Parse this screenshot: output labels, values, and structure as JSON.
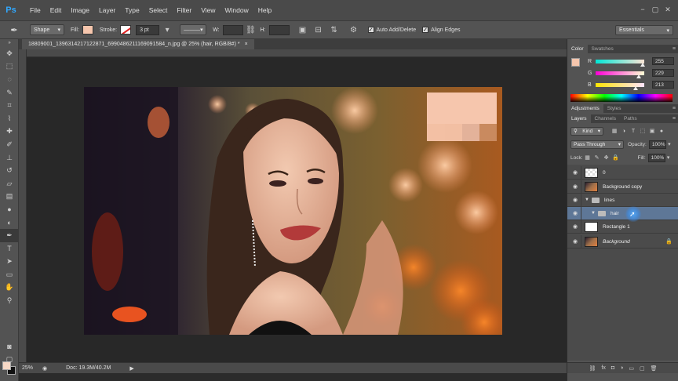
{
  "app": {
    "logo": "Ps"
  },
  "menu": [
    "File",
    "Edit",
    "Image",
    "Layer",
    "Type",
    "Select",
    "Filter",
    "View",
    "Window",
    "Help"
  ],
  "window_controls": [
    "−",
    "▢",
    "✕"
  ],
  "options": {
    "tool_mode": "Shape",
    "fill_label": "Fill:",
    "stroke_label": "Stroke:",
    "stroke_size": "3 pt",
    "w_label": "W:",
    "h_label": "H:",
    "auto_add_delete": "Auto Add/Delete",
    "align_edges": "Align Edges",
    "workspace": "Essentials"
  },
  "document": {
    "tab_title": "18809001_1396314217122871_6990486211169091584_n.jpg @ 25% (hair, RGB/8#) *",
    "close": "×",
    "zoom": "25%",
    "doc_size": "Doc: 19.3M/40.2M",
    "palette_colors": [
      "#f6c6ad",
      "#f3c0a4",
      "#e3b29a",
      "#d9a585",
      "#c98a5f"
    ]
  },
  "color_panel": {
    "tabs": [
      "Color",
      "Swatches"
    ],
    "current": "#f6c6ad",
    "sliders": [
      {
        "label": "R",
        "value": "255",
        "fraction": 0.97
      },
      {
        "label": "G",
        "value": "229",
        "fraction": 0.88
      },
      {
        "label": "B",
        "value": "213",
        "fraction": 0.82
      }
    ]
  },
  "adjustments_tabs": [
    "Adjustments",
    "Styles"
  ],
  "layers_panel": {
    "tabs": [
      "Layers",
      "Channels",
      "Paths"
    ],
    "kind": "Kind",
    "blend_mode": "Pass Through",
    "opacity_label": "Opacity:",
    "opacity": "100%",
    "lock_label": "Lock:",
    "fill_label": "Fill:",
    "fill": "100%",
    "layers": [
      {
        "name": "0",
        "type": "pixel",
        "selected": false
      },
      {
        "name": "Background copy",
        "type": "photo",
        "selected": false
      },
      {
        "name": "lines",
        "type": "group",
        "selected": false
      },
      {
        "name": "hair",
        "type": "group",
        "selected": true
      },
      {
        "name": "Rectangle 1",
        "type": "shape",
        "selected": false
      },
      {
        "name": "Background",
        "type": "photo-locked",
        "selected": false
      }
    ]
  }
}
